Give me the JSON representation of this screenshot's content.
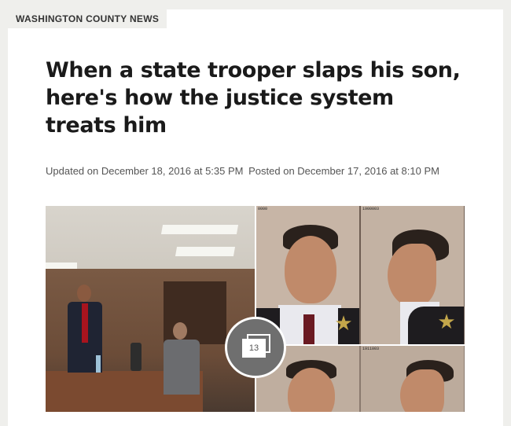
{
  "section": {
    "label": "WASHINGTON COUNTY NEWS"
  },
  "article": {
    "headline": "When a state trooper slaps his son, here's how the justice system treats him",
    "updated": "Updated on December 18, 2016 at 5:35 PM",
    "posted": "Posted on December 17, 2016 at 8:10 PM"
  },
  "gallery": {
    "photo_count": "13",
    "mugshot_labels": [
      "0000",
      "1900003",
      "1911003"
    ]
  },
  "colors": {
    "background": "#efefec",
    "card": "#ffffff",
    "badge": "#6f6f6f"
  }
}
